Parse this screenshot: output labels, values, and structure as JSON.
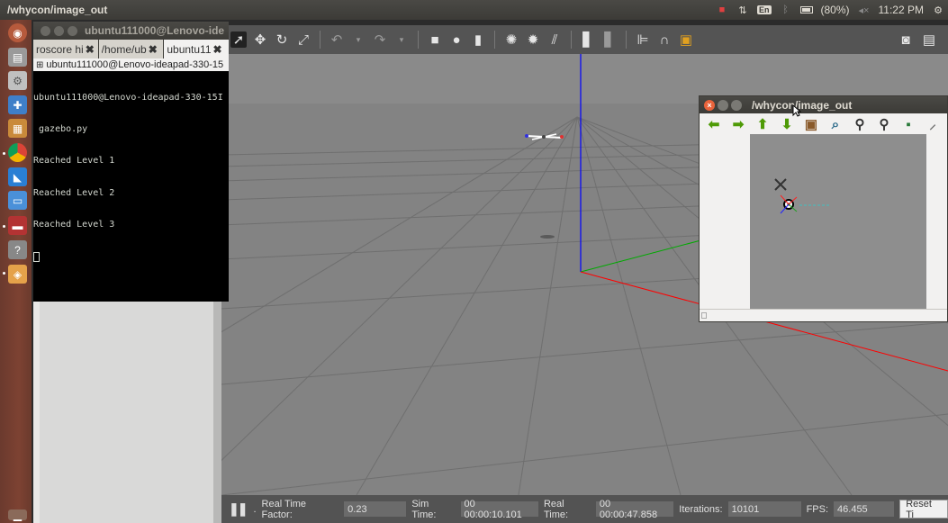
{
  "panel": {
    "title": "/whycon/image_out",
    "battery": "(80%)",
    "language": "En",
    "clock": "11:22 PM"
  },
  "terminal": {
    "title": "ubuntu111000@Lenovo-ide",
    "tabs": [
      {
        "label": "roscore hi"
      },
      {
        "label": "/home/ub"
      },
      {
        "label": "ubuntu11"
      }
    ],
    "inner_title": "ubuntu111000@Lenovo-ideapad-330-15",
    "lines": [
      "ubuntu111000@Lenovo-ideapad-330-15I",
      " gazebo.py",
      "Reached Level 1",
      "Reached Level 2",
      "Reached Level 3"
    ]
  },
  "image_window": {
    "title": "/whycon/image_out"
  },
  "gazebo_status": {
    "rtf_label": "Real Time Factor:",
    "rtf_value": "0.23",
    "sim_time_label": "Sim Time:",
    "sim_time_value": "00 00:00:10.101",
    "real_time_label": "Real Time:",
    "real_time_value": "00 00:00:47.858",
    "iterations_label": "Iterations:",
    "iterations_value": "10101",
    "fps_label": "FPS:",
    "fps_value": "46.455",
    "reset_label": "Reset Ti"
  },
  "colors": {
    "ubuntu_panel": "#3c3b37",
    "launcher": "#7d4232",
    "close_button": "#e9633b",
    "arrow_green": "#4e9a06",
    "axis_blue": "#0000ff",
    "axis_red": "#ff0000",
    "axis_green": "#00aa00"
  }
}
